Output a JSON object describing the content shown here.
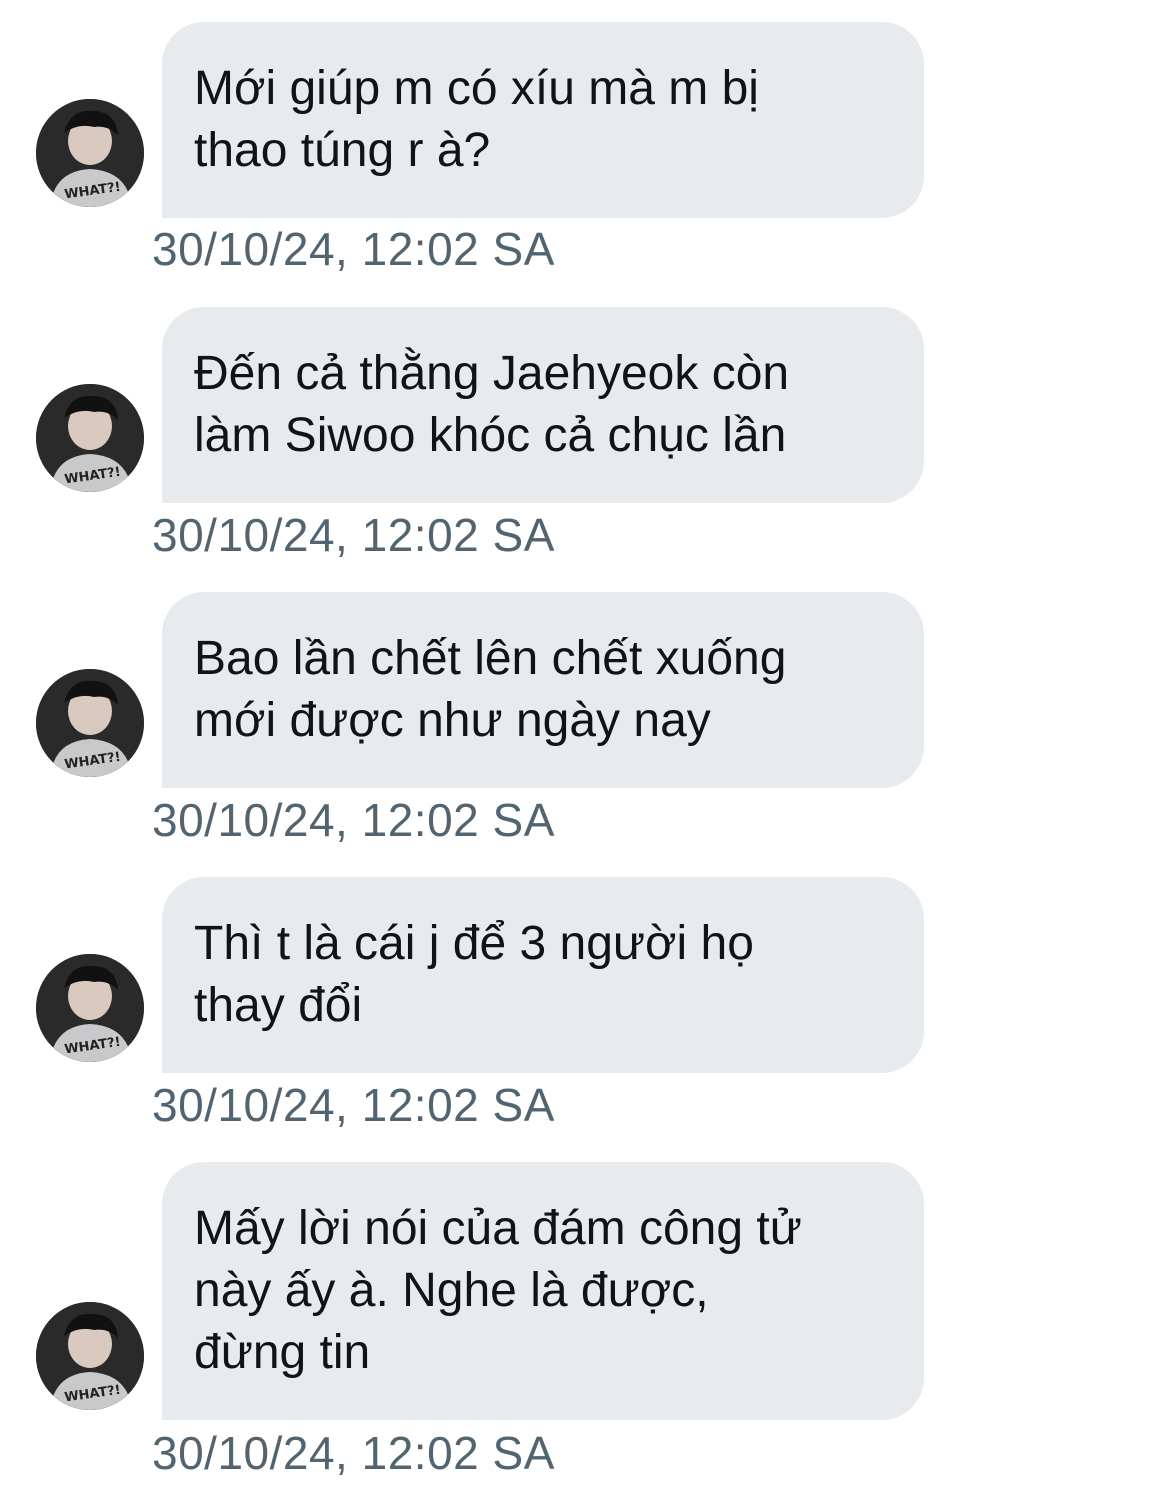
{
  "theme": {
    "bubble_color": "#e8ebee",
    "text_color": "#0f1419",
    "timestamp_color": "#536471",
    "background": "#ffffff"
  },
  "messages": [
    {
      "text_lines": [
        "Mới giúp m có xíu mà m bị",
        "thao túng r à?"
      ],
      "timestamp": "30/10/24, 12:02 SA",
      "avatar_icon": "user-avatar-icon"
    },
    {
      "text_lines": [
        "Đến cả thằng Jaehyeok còn",
        "làm Siwoo khóc cả chục lần"
      ],
      "timestamp": "30/10/24, 12:02 SA",
      "avatar_icon": "user-avatar-icon"
    },
    {
      "text_lines": [
        "Bao lần chết lên chết xuống",
        "mới được như ngày nay"
      ],
      "timestamp": "30/10/24, 12:02 SA",
      "avatar_icon": "user-avatar-icon"
    },
    {
      "text_lines": [
        "Thì t là cái j để 3 người họ",
        "thay đổi"
      ],
      "timestamp": "30/10/24, 12:02 SA",
      "avatar_icon": "user-avatar-icon"
    },
    {
      "text_lines": [
        "Mấy lời nói của đám công tử",
        "này ấy à. Nghe là được,",
        "đừng tin"
      ],
      "timestamp": "30/10/24, 12:02 SA",
      "avatar_icon": "user-avatar-icon"
    }
  ]
}
